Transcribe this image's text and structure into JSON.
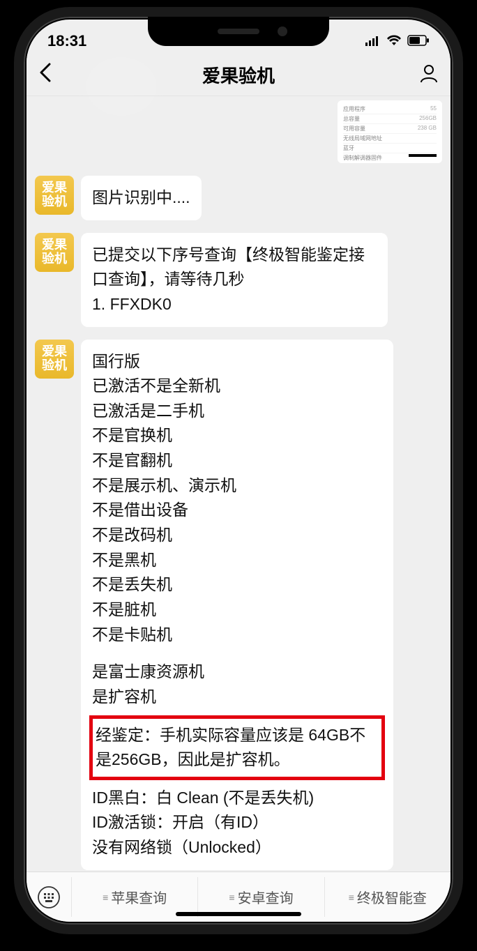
{
  "statusbar": {
    "time": "18:31"
  },
  "nav": {
    "title": "爱果验机"
  },
  "avatar_text": "爱果\n验机",
  "thumb": {
    "rows": [
      {
        "l": "应用程序",
        "r": "55"
      },
      {
        "l": "总容量",
        "r": "256GB"
      },
      {
        "l": "可用容量",
        "r": "238 GB"
      },
      {
        "l": "无线局域网地址",
        "r": ""
      },
      {
        "l": "蓝牙",
        "r": ""
      },
      {
        "l": "调制解调器固件",
        "r": ""
      }
    ]
  },
  "msg1": "图片识别中....",
  "msg2": {
    "line1": "已提交以下序号查询【终极智能鉴定接口查询】，请等待几秒",
    "line2": "1. FFXDK0"
  },
  "report": {
    "lines": [
      "国行版",
      "已激活不是全新机",
      "已激活是二手机",
      "不是官换机",
      "不是官翻机",
      "不是展示机、演示机",
      "不是借出设备",
      "不是改码机",
      "不是黑机",
      "不是丢失机",
      "不是脏机",
      "不是卡贴机"
    ],
    "lines2": [
      "是富士康资源机",
      "是扩容机"
    ],
    "verdict": "经鉴定：手机实际容量应该是 64GB不是256GB，因此是扩容机。",
    "tail": [
      "ID黑白：白 Clean (不是丢失机)",
      "ID激活锁：开启（有ID）",
      "没有网络锁（Unlocked）"
    ]
  },
  "bottom": {
    "tab1": "苹果查询",
    "tab2": "安卓查询",
    "tab3": "终极智能查"
  }
}
